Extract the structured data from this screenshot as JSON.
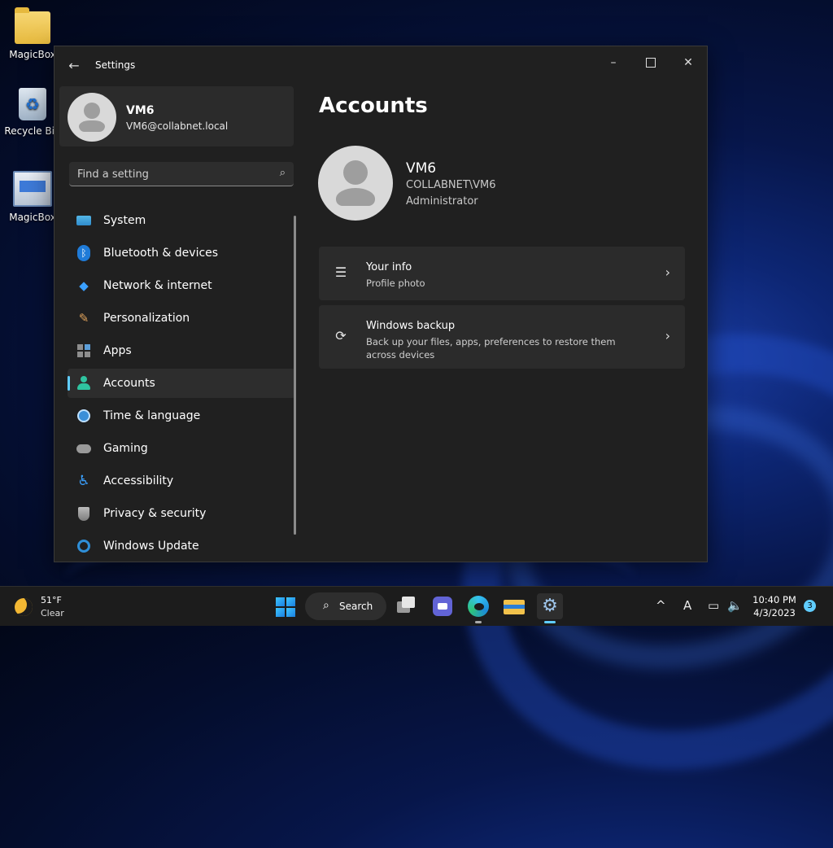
{
  "desktop": {
    "icons": [
      {
        "label": "MagicBox"
      },
      {
        "label": "Recycle Bin"
      },
      {
        "label": "MagicBox"
      }
    ]
  },
  "window": {
    "title": "Settings",
    "controls": {
      "minimize": "–",
      "maximize": "□",
      "close": "✕"
    }
  },
  "sidebar": {
    "profile": {
      "name": "VM6",
      "email": "VM6@collabnet.local"
    },
    "search": {
      "placeholder": "Find a setting",
      "icon": "search-icon"
    },
    "items": [
      {
        "label": "System",
        "icon": "system-icon"
      },
      {
        "label": "Bluetooth & devices",
        "icon": "bluetooth-icon"
      },
      {
        "label": "Network & internet",
        "icon": "wifi-icon"
      },
      {
        "label": "Personalization",
        "icon": "brush-icon"
      },
      {
        "label": "Apps",
        "icon": "apps-icon"
      },
      {
        "label": "Accounts",
        "icon": "accounts-icon",
        "selected": true
      },
      {
        "label": "Time & language",
        "icon": "clock-globe-icon"
      },
      {
        "label": "Gaming",
        "icon": "controller-icon"
      },
      {
        "label": "Accessibility",
        "icon": "accessibility-icon"
      },
      {
        "label": "Privacy & security",
        "icon": "shield-icon"
      },
      {
        "label": "Windows Update",
        "icon": "update-icon"
      }
    ]
  },
  "main": {
    "title": "Accounts",
    "account": {
      "name": "VM6",
      "domain": "COLLABNET\\VM6",
      "role": "Administrator"
    },
    "cards": [
      {
        "title": "Your info",
        "subtitle": "Profile photo",
        "icon": "user-info-icon"
      },
      {
        "title": "Windows backup",
        "subtitle": "Back up your files, apps, preferences to restore them across devices",
        "icon": "backup-icon"
      }
    ]
  },
  "taskbar": {
    "weather": {
      "temp": "51°F",
      "condition": "Clear"
    },
    "search_label": "Search",
    "clock": {
      "time": "10:40 PM",
      "date": "4/3/2023"
    },
    "notifications": "3",
    "tray": {
      "chevron": "^",
      "ime": "A"
    }
  },
  "colors": {
    "accent": "#60cdff",
    "window_bg": "#202020",
    "card_bg": "#2b2b2b"
  }
}
